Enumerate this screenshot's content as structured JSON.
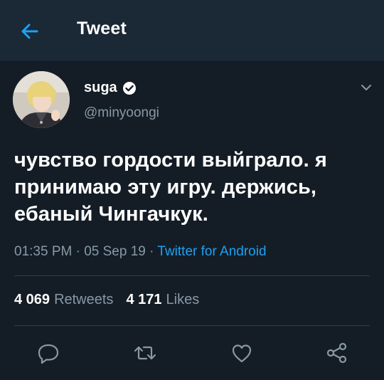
{
  "header": {
    "title": "Tweet",
    "back_icon": "arrow-left-icon"
  },
  "tweet": {
    "author": {
      "name": "suga",
      "handle": "@minyoongi",
      "verified": true
    },
    "text": "чувство гордости выйграло. я принимаю эту игру. держись, ебаный Чингачкук.",
    "time": "01:35 PM",
    "separator": "·",
    "date": "05 Sep 19",
    "source": "Twitter for Android",
    "retweets_count": "4 069",
    "retweets_label": "Retweets",
    "likes_count": "4 171",
    "likes_label": "Likes"
  },
  "actions": [
    {
      "name": "reply",
      "icon": "reply-icon"
    },
    {
      "name": "retweet",
      "icon": "retweet-icon"
    },
    {
      "name": "like",
      "icon": "heart-icon"
    },
    {
      "name": "share",
      "icon": "share-icon"
    }
  ],
  "colors": {
    "background": "#141d26",
    "header": "#1b2836",
    "accent": "#1da1f2",
    "secondary_text": "#8899a6",
    "divider": "#2f3d4c"
  }
}
